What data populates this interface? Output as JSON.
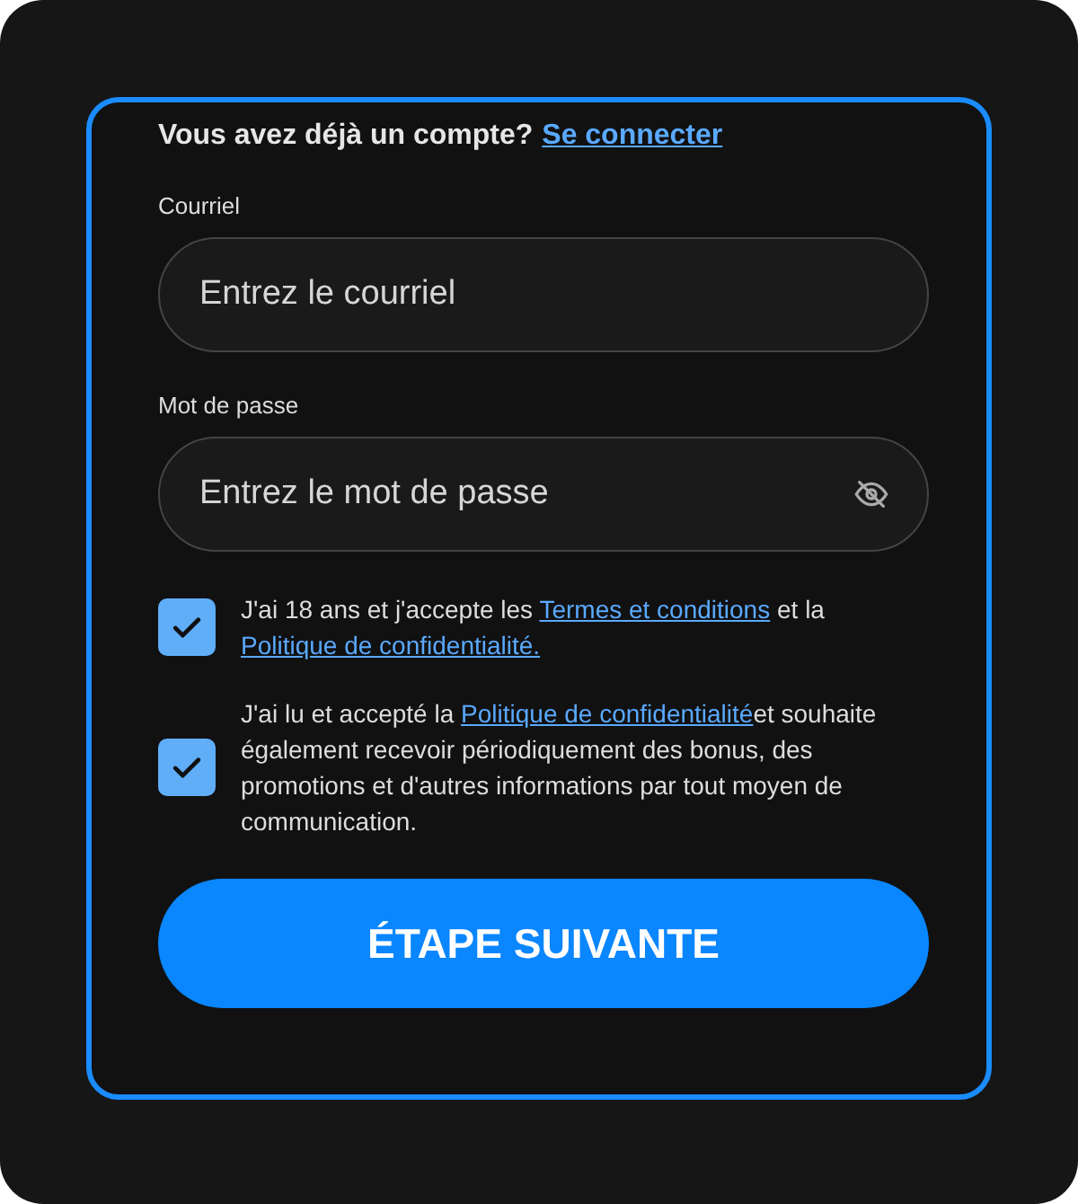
{
  "login_prompt": {
    "text": "Vous avez déjà un compte?",
    "link": "Se connecter"
  },
  "fields": [
    {
      "label": "Courriel",
      "placeholder": "Entrez le courriel",
      "kind": "email"
    },
    {
      "label": "Mot de passe",
      "placeholder": "Entrez le mot de passe",
      "kind": "password"
    }
  ],
  "consents": [
    {
      "checked": true,
      "parts": [
        {
          "text": "J'ai 18 ans et j'accepte les "
        },
        {
          "link": "Termes et conditions"
        },
        {
          "text": " et la "
        },
        {
          "link": "Politique de confidentialité."
        }
      ]
    },
    {
      "checked": true,
      "parts": [
        {
          "text": "J'ai lu et accepté la "
        },
        {
          "link": "Politique de confidentialité"
        },
        {
          "text": "et souhaite également recevoir périodiquement des bonus, des promotions et d'autres informations par tout moyen de communication."
        }
      ]
    }
  ],
  "submit_button": "ÉTAPE SUIVANTE"
}
